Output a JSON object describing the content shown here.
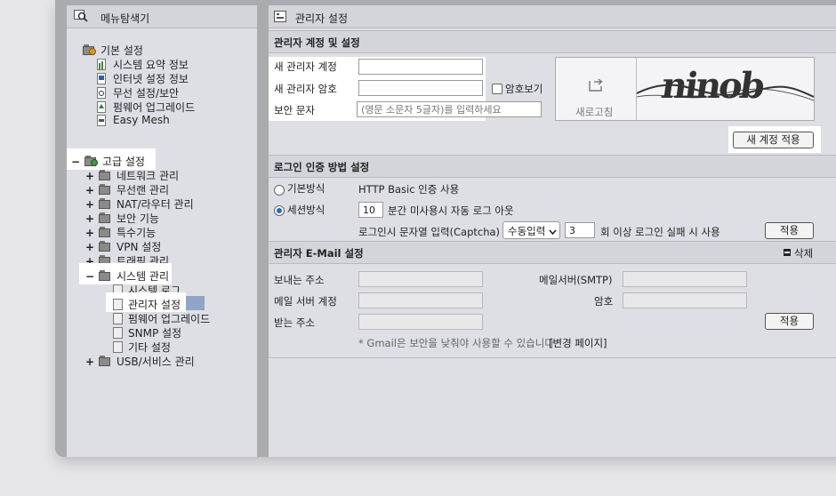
{
  "menu": {
    "title": "메뉴탐색기",
    "basic": {
      "label": "기본 설정",
      "items": [
        "시스템 요약 정보",
        "인터넷 설정 정보",
        "무선 설정/보안",
        "펌웨어 업그레이드",
        "Easy Mesh"
      ]
    },
    "advanced": {
      "toggle": "−",
      "label": "고급 설정",
      "groups": [
        "네트워크 관리",
        "무선랜 관리",
        "NAT/라우터 관리",
        "보안 기능",
        "특수기능",
        "VPN 설정",
        "트래픽 관리"
      ],
      "system": {
        "toggle": "−",
        "label": "시스템 관리",
        "items": [
          "시스템 로그",
          "관리자 설정",
          "펌웨어 업그레이드",
          "SNMP 설정",
          "기타 설정"
        ]
      },
      "usb": "USB/서비스 관리",
      "plus": "+"
    }
  },
  "page": {
    "title": "관리자 설정",
    "account": {
      "header": "관리자 계정 및 설정",
      "new_id_label": "새 관리자 계정",
      "new_pw_label": "새 관리자 암호",
      "show_pw_label": "암호보기",
      "captcha_label": "보안 문자",
      "captcha_placeholder": "(영문 소문자 5글자)를 입력하세요",
      "refresh_label": "새로고침",
      "captcha_text": "ninob",
      "apply_button": "새 계정 적용"
    },
    "login": {
      "header": "로그인 인증 방법 설정",
      "basic_label": "기본방식",
      "basic_desc": "HTTP Basic 인증 사용",
      "session_label": "세션방식",
      "session_minutes": "10",
      "session_desc": "분간 미사용시 자동 로그 아웃",
      "captcha_desc": "로그인시 문자열 입력(Captcha)",
      "captcha_mode": "수동입력",
      "fail_count": "3",
      "fail_desc": "회 이상 로그인 실패 시 사용",
      "apply_button": "적용"
    },
    "email": {
      "header": "관리자 E-Mail 설정",
      "delete_label": "삭제",
      "sender_label": "보내는 주소",
      "smtp_label": "메일서버(SMTP)",
      "account_label": "메일 서버 계정",
      "password_label": "암호",
      "recipient_label": "받는 주소",
      "apply_button": "적용",
      "note": "* Gmail은 보안을 낮춰야 사용할 수 있습니다",
      "change_link": "[변경 페이지]"
    }
  }
}
